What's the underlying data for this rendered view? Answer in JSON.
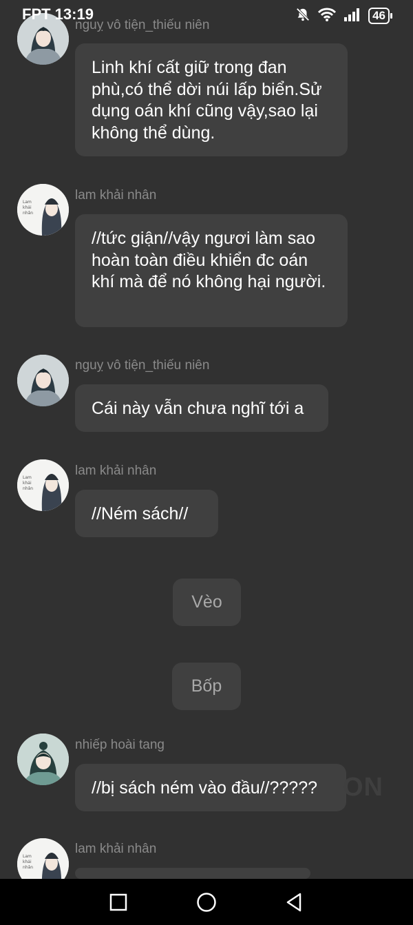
{
  "status_bar": {
    "carrier_time": "FPT 13:19",
    "battery": "46"
  },
  "messages": [
    {
      "sender": "nguỵ vô tiện_thiếu niên",
      "text": "Linh khí cất giữ trong đan phù,có thể dời núi lấp biển.Sử dụng oán khí cũng vậy,sao lại không thể dùng."
    },
    {
      "sender": "lam khải nhân",
      "text": "//tức giận//vậy ngươi làm sao hoàn toàn điều khiển đc oán khí mà để nó không hại người."
    },
    {
      "sender": "nguỵ vô tiện_thiếu niên",
      "text": "Cái này vẫn chưa nghĩ tới a"
    },
    {
      "sender": "lam khải nhân",
      "text": "//Ném sách//"
    },
    {
      "sender": "nhiếp hoài tang",
      "text": "//bị sách ném vào đầu//?????"
    },
    {
      "sender": "lam khải nhân",
      "text": ""
    }
  ],
  "sound_effects": [
    "Vèo",
    "Bốp"
  ],
  "watermark": "ON",
  "icons": {
    "nav_recent": "square-icon",
    "nav_home": "circle-icon",
    "nav_back": "triangle-back-icon",
    "mute": "bell-off-icon",
    "wifi": "wifi-icon",
    "signal": "signal-icon"
  },
  "colors": {
    "background": "#313131",
    "bubble": "#404040",
    "sender_text": "#8a8a8a",
    "message_text": "#ffffff",
    "nav_bar": "#000000"
  }
}
